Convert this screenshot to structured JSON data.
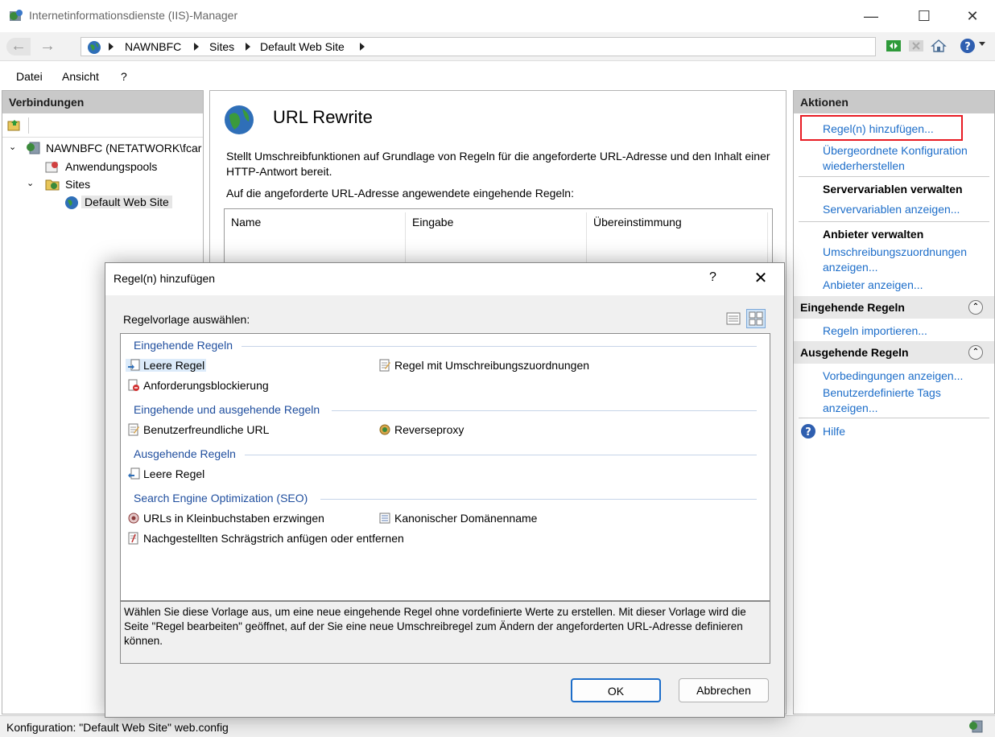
{
  "window": {
    "title": "Internetinformationsdienste (IIS)-Manager",
    "minimize": "—",
    "maximize": "☐",
    "close": "✕"
  },
  "address": {
    "crumbs": [
      "NAWNBFC",
      "Sites",
      "Default Web Site"
    ]
  },
  "menu": {
    "datei": "Datei",
    "ansicht": "Ansicht",
    "help": "?"
  },
  "connections": {
    "header": "Verbindungen",
    "server": "NAWNBFC (NETATWORK\\fcar",
    "app_pools": "Anwendungspools",
    "sites": "Sites",
    "site": "Default Web Site"
  },
  "feature": {
    "title": "URL Rewrite",
    "description": "Stellt Umschreibfunktionen auf Grundlage von Regeln für die angeforderte URL-Adresse und den Inhalt einer HTTP-Antwort bereit.",
    "rules_label": "Auf die angeforderte URL-Adresse angewendete eingehende Regeln:",
    "columns": [
      "Name",
      "Eingabe",
      "Übereinstimmung"
    ]
  },
  "actions": {
    "header": "Aktionen",
    "add_rules": "Regel(n) hinzufügen...",
    "restore_config": "Übergeordnete Konfiguration wiederherstellen",
    "server_vars_group": "Servervariablen verwalten",
    "server_vars_show": "Servervariablen anzeigen...",
    "providers_group": "Anbieter verwalten",
    "rewrite_maps_show": "Umschreibungszuordnungen anzeigen...",
    "providers_show": "Anbieter anzeigen...",
    "inbound_section": "Eingehende Regeln",
    "import_rules": "Regeln importieren...",
    "outbound_section": "Ausgehende Regeln",
    "preconditions_show": "Vorbedingungen anzeigen...",
    "custom_tags_show": "Benutzerdefinierte Tags anzeigen...",
    "help": "Hilfe"
  },
  "status": {
    "text": "Konfiguration: \"Default Web Site\" web.config"
  },
  "dialog": {
    "title": "Regel(n) hinzufügen",
    "help": "?",
    "close": "✕",
    "template_label": "Regelvorlage auswählen:",
    "groups": {
      "inbound": "Eingehende Regeln",
      "inout": "Eingehende und ausgehende Regeln",
      "outbound": "Ausgehende Regeln",
      "seo": "Search Engine Optimization (SEO)"
    },
    "templates": {
      "blank_in": "Leere Regel",
      "rewrite_map": "Regel mit Umschreibungszuordnungen",
      "request_block": "Anforderungsblockierung",
      "friendly_url": "Benutzerfreundliche URL",
      "reverse_proxy": "Reverseproxy",
      "blank_out": "Leere Regel",
      "lowercase": "URLs in Kleinbuchstaben erzwingen",
      "canonical": "Kanonischer Domänenname",
      "trailing_slash": "Nachgestellten Schrägstrich anfügen oder entfernen"
    },
    "description": "Wählen Sie diese Vorlage aus, um eine neue eingehende Regel ohne vordefinierte Werte zu erstellen. Mit dieser Vorlage wird die Seite \"Regel bearbeiten\" geöffnet, auf der Sie eine neue Umschreibregel zum Ändern der angeforderten URL-Adresse definieren können.",
    "ok": "OK",
    "cancel": "Abbrechen"
  },
  "colors": {
    "link": "#1c6dc9",
    "highlight": "#e81b23",
    "group_text": "#1f4e9e"
  }
}
